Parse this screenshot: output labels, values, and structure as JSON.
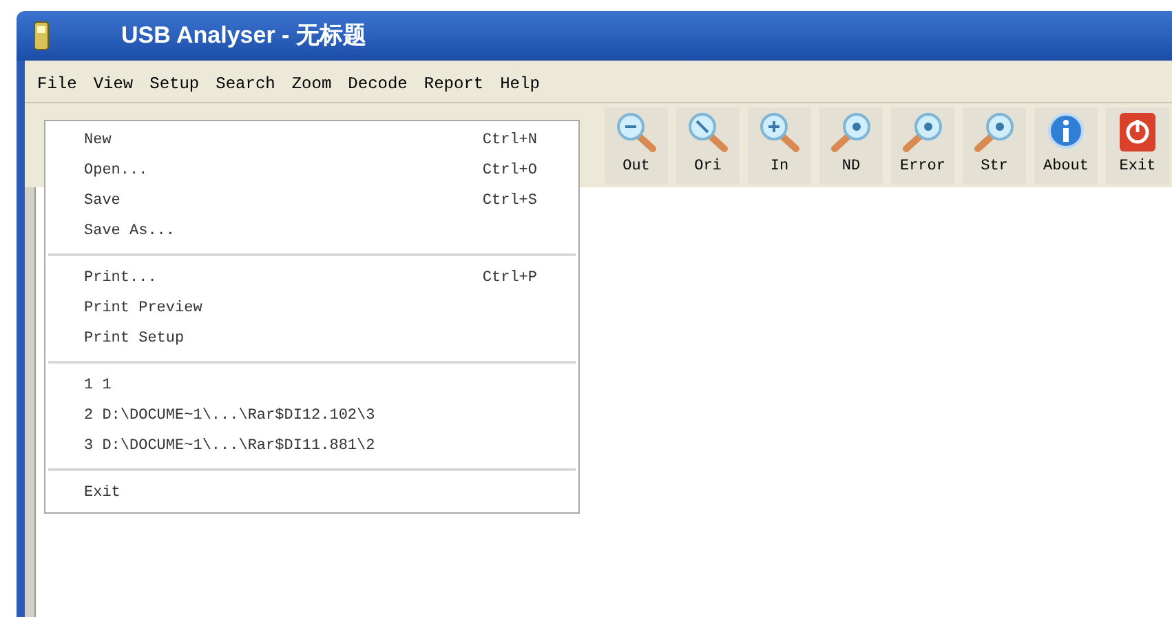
{
  "window": {
    "title": "USB Analyser - 无标题"
  },
  "menu_bar": [
    {
      "label": "File"
    },
    {
      "label": "View"
    },
    {
      "label": "Setup"
    },
    {
      "label": "Search"
    },
    {
      "label": "Zoom"
    },
    {
      "label": "Decode"
    },
    {
      "label": "Report"
    },
    {
      "label": "Help"
    }
  ],
  "toolbar": [
    {
      "label": "Out",
      "kind": "zoom-out"
    },
    {
      "label": "Ori",
      "kind": "zoom-reset"
    },
    {
      "label": "In",
      "kind": "zoom-in"
    },
    {
      "label": "ND",
      "kind": "find"
    },
    {
      "label": "Error",
      "kind": "find"
    },
    {
      "label": "Str",
      "kind": "find"
    },
    {
      "label": "About",
      "kind": "info"
    },
    {
      "label": "Exit",
      "kind": "power"
    }
  ],
  "file_menu": [
    {
      "kind": "item",
      "label": "New",
      "shortcut": "Ctrl+N"
    },
    {
      "kind": "item",
      "label": "Open...",
      "shortcut": "Ctrl+O"
    },
    {
      "kind": "item",
      "label": "Save",
      "shortcut": "Ctrl+S"
    },
    {
      "kind": "item",
      "label": "Save As..."
    },
    {
      "kind": "separator"
    },
    {
      "kind": "item",
      "label": "Print...",
      "shortcut": "Ctrl+P"
    },
    {
      "kind": "item",
      "label": "Print Preview"
    },
    {
      "kind": "item",
      "label": "Print Setup"
    },
    {
      "kind": "separator"
    },
    {
      "kind": "item",
      "label": "1 1"
    },
    {
      "kind": "item",
      "label": "2 D:\\DOCUME~1\\...\\Rar$DI12.102\\3"
    },
    {
      "kind": "item",
      "label": "3 D:\\DOCUME~1\\...\\Rar$DI11.881\\2"
    },
    {
      "kind": "separator"
    },
    {
      "kind": "item",
      "label": "Exit"
    }
  ]
}
